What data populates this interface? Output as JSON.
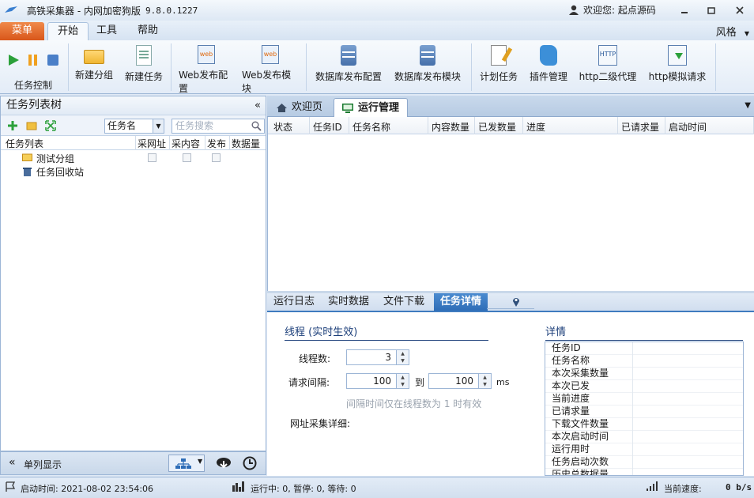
{
  "window": {
    "title": "高铁采集器 - 内网加密狗版",
    "version": "9.8.0.1227",
    "user_greeting": "欢迎您: 起点源码"
  },
  "menu": {
    "app_tab": "菜单",
    "tabs": [
      "开始",
      "工具",
      "帮助"
    ],
    "style_menu": "风格"
  },
  "ribbon": {
    "task_control_label": "任务控制",
    "buttons": [
      {
        "label": "新建分组",
        "icon": "folder-icon"
      },
      {
        "label": "新建任务",
        "icon": "new-task-icon"
      },
      {
        "label": "Web发布配置",
        "icon": "web-config-icon"
      },
      {
        "label": "Web发布模块",
        "icon": "web-module-icon"
      },
      {
        "label": "数据库发布配置",
        "icon": "db-config-icon"
      },
      {
        "label": "数据库发布模块",
        "icon": "db-module-icon"
      },
      {
        "label": "计划任务",
        "icon": "schedule-icon"
      },
      {
        "label": "插件管理",
        "icon": "plugin-icon"
      },
      {
        "label": "http二级代理",
        "icon": "http-proxy-icon"
      },
      {
        "label": "http模拟请求",
        "icon": "http-request-icon"
      }
    ],
    "web_icon_text": "web",
    "http_icon_text": "HTTP"
  },
  "left_panel": {
    "title": "任务列表树",
    "select_value": "任务名",
    "search_placeholder": "任务搜索",
    "columns": [
      "任务列表",
      "采网址",
      "采内容",
      "发布",
      "数据量"
    ],
    "tree_items": [
      "测试分组",
      "任务回收站"
    ],
    "footer_label": "单列显示"
  },
  "doc_tabs": [
    "欢迎页",
    "运行管理"
  ],
  "grid": {
    "columns": [
      "状态",
      "任务ID",
      "任务名称",
      "内容数量",
      "已发数量",
      "进度",
      "已请求量",
      "启动时间"
    ]
  },
  "bottom_tabs": [
    "运行日志",
    "实时数据",
    "文件下载",
    "任务详情"
  ],
  "details": {
    "thread_title": "线程 (实时生效)",
    "thread_label": "线程数:",
    "thread_value": "3",
    "interval_label": "请求间隔:",
    "interval_from": "100",
    "interval_to_label": "到",
    "interval_to": "100",
    "interval_unit": "ms",
    "interval_hint": "间隔时间仅在线程数为 1 时有效",
    "url_detail_label": "网址采集详细:",
    "info_title": "详情",
    "info_rows": [
      "任务ID",
      "任务名称",
      "本次采集数量",
      "本次已发",
      "当前进度",
      "已请求量",
      "下载文件数量",
      "本次启动时间",
      "运行用时",
      "任务启动次数",
      "历史总数据量"
    ]
  },
  "status": {
    "start_time": "启动时间: 2021-08-02 23:54:06",
    "run_status": "运行中: 0, 暂停: 0, 等待: 0",
    "speed_label": "当前速度:",
    "speed_value": "0 b/s"
  },
  "colors": {
    "accent": "#2e6db7",
    "app_tab": "#e06a2a",
    "play": "#2ba03a",
    "pause": "#f0a020",
    "stop": "#4a7fc8"
  }
}
